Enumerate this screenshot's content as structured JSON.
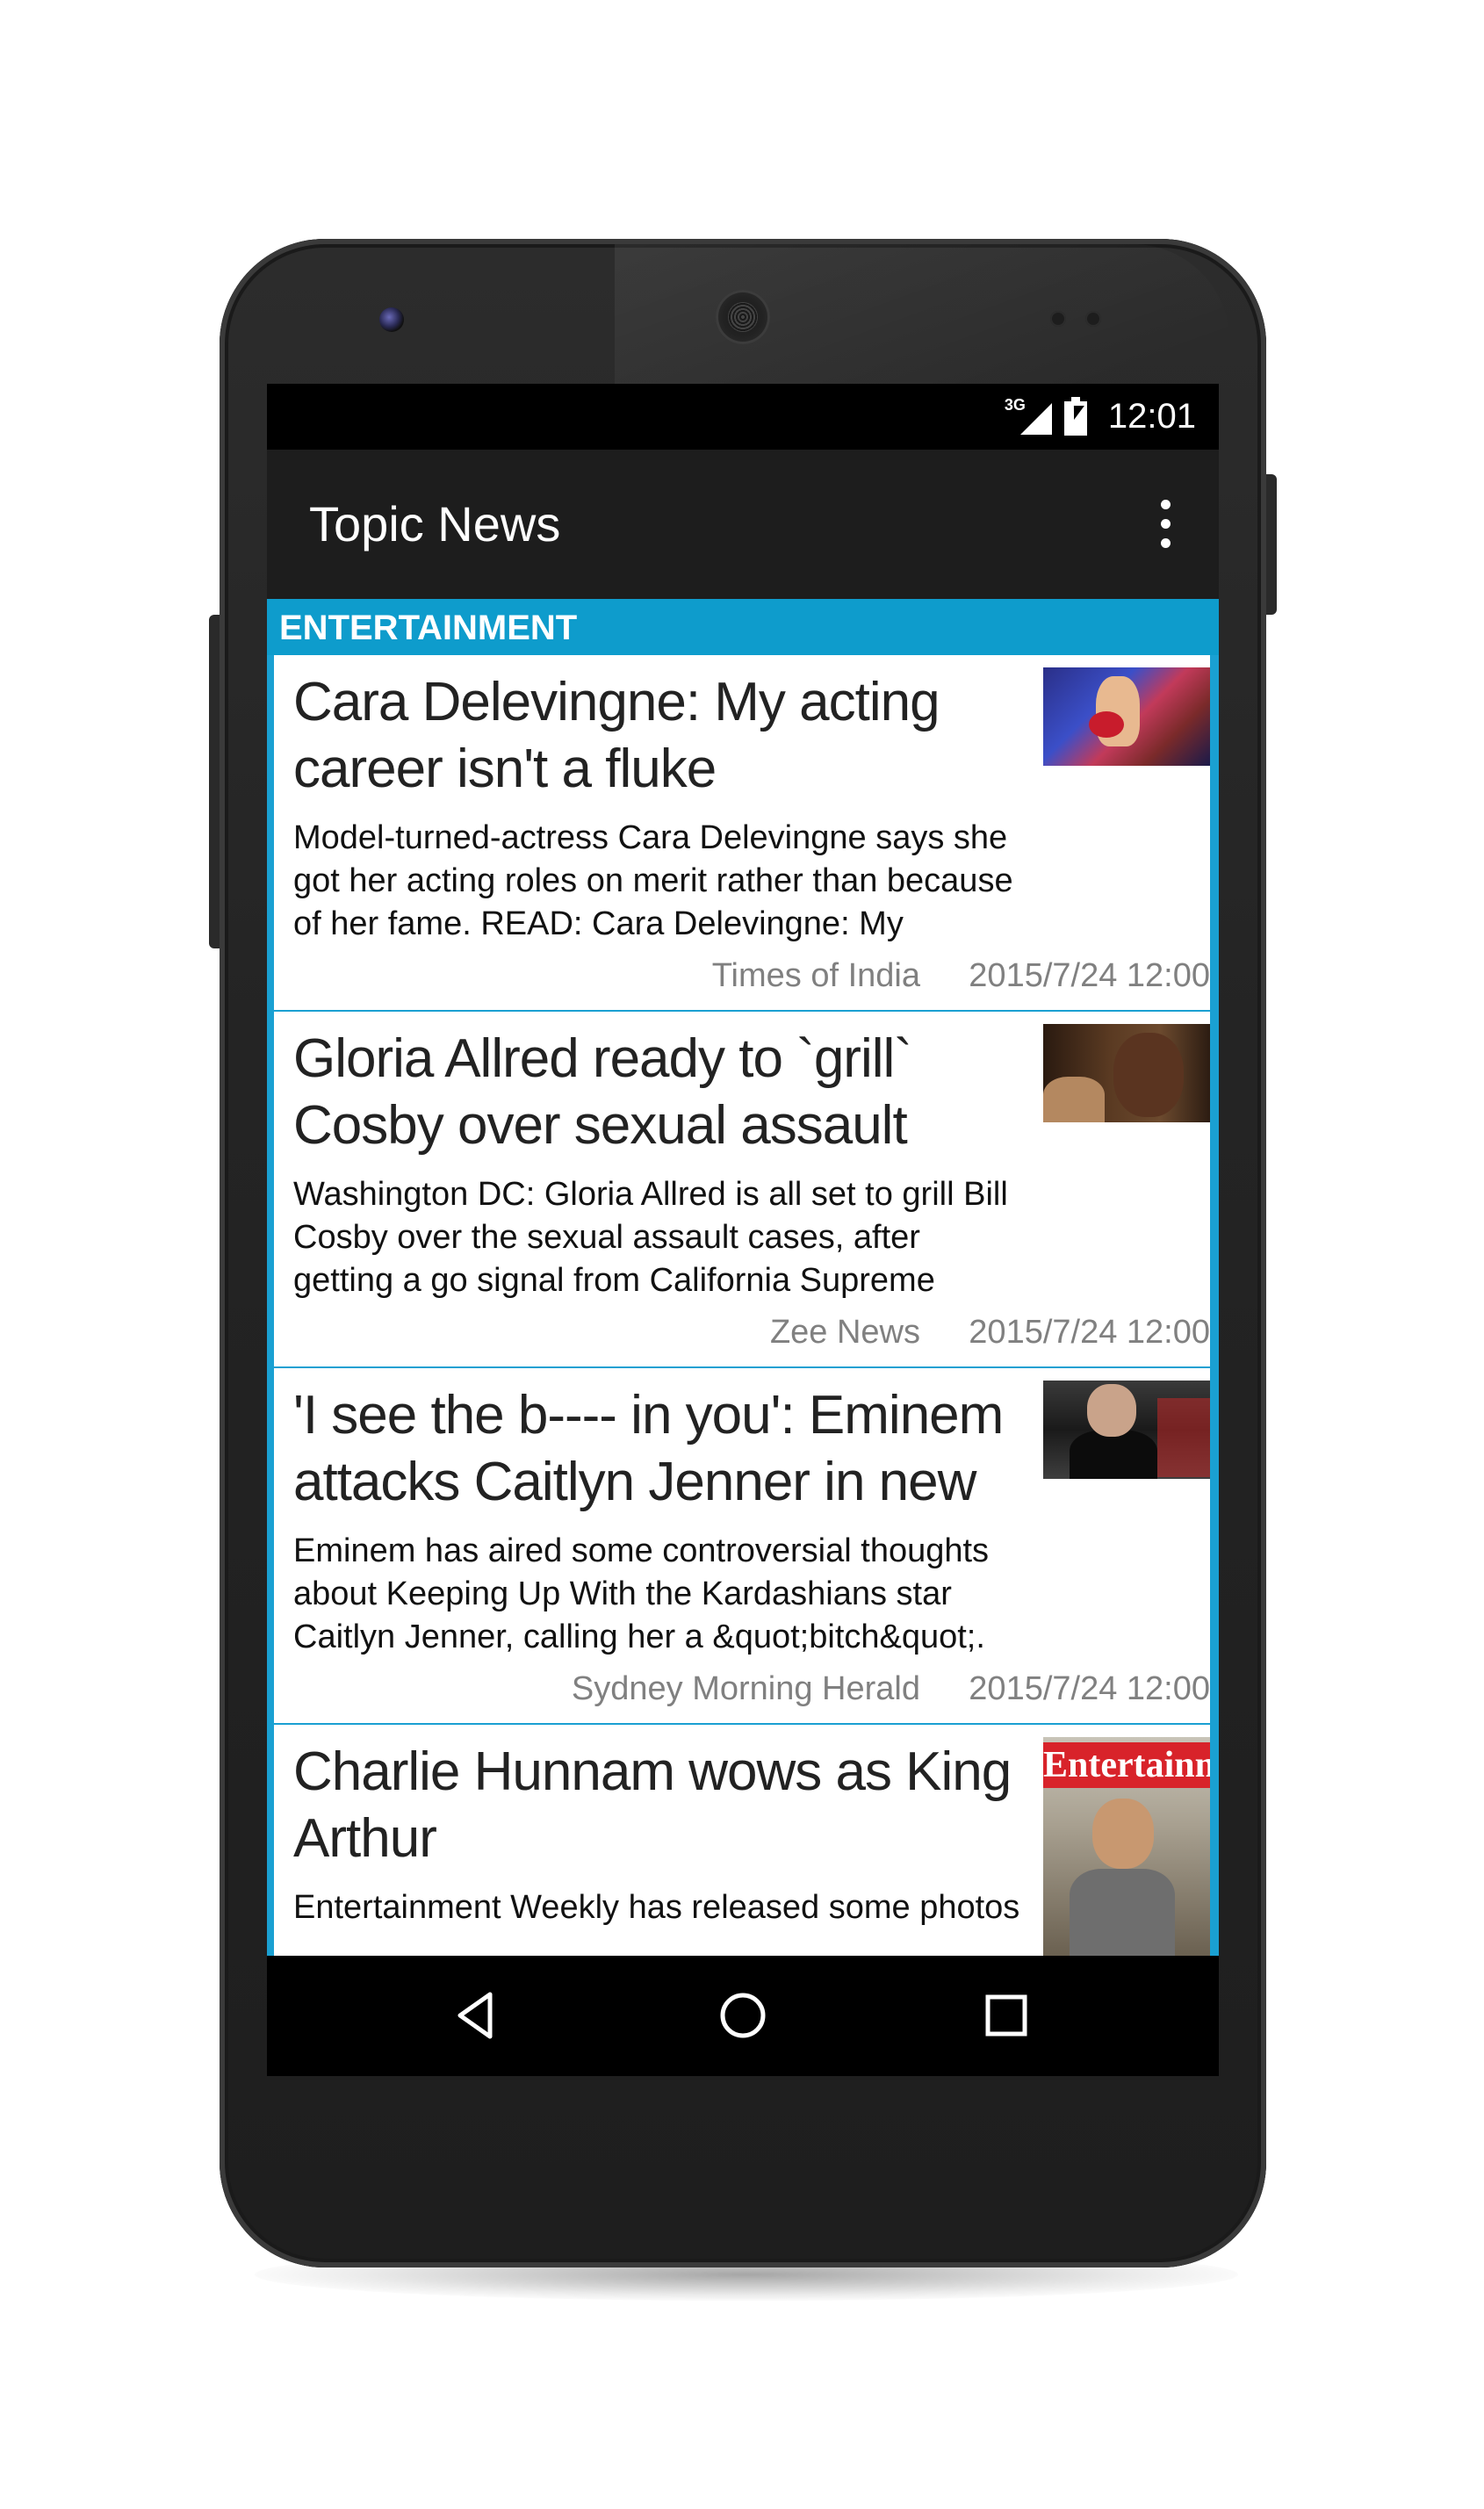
{
  "status_bar": {
    "network_label": "3G",
    "time": "12:01"
  },
  "app_bar": {
    "title": "Topic News"
  },
  "section": {
    "header": "ENTERTAINMENT"
  },
  "articles": [
    {
      "title": "Cara Delevingne: My acting career isn't a fluke",
      "summary": "Model-turned-actress Cara Delevingne says she got her acting roles on merit rather than because of her fame. READ: Cara Delevingne: My sexuality",
      "source": "Times of India",
      "date": "2015/7/24 12:00"
    },
    {
      "title": "Gloria Allred ready to `grill` Cosby over sexual assault",
      "summary": "Washington DC: Gloria Allred is all set to grill Bill Cosby over the sexual assault cases, after getting a go signal from California Supreme Court. The",
      "source": "Zee News",
      "date": "2015/7/24 12:00"
    },
    {
      "title": "'I see the b---- in you': Eminem attacks Caitlyn Jenner in new",
      "summary": "Eminem has aired some controversial thoughts about Keeping Up With the Kardashians star Caitlyn Jenner, calling her a &quot;bitch&quot;.",
      "source": "Sydney Morning Herald",
      "date": "2015/7/24 12:00"
    },
    {
      "title": "Charlie Hunnam wows as King Arthur",
      "summary": "Entertainment Weekly has released some photos",
      "thumbnail_masthead": "Entertainment"
    }
  ],
  "colors": {
    "accent": "#0e9ccc",
    "app_bar": "#1d1d1d",
    "meta_text": "#808080"
  },
  "icons": {
    "overflow": "more-vert-icon",
    "back": "back-icon",
    "home": "home-icon",
    "recent": "recent-apps-icon"
  }
}
